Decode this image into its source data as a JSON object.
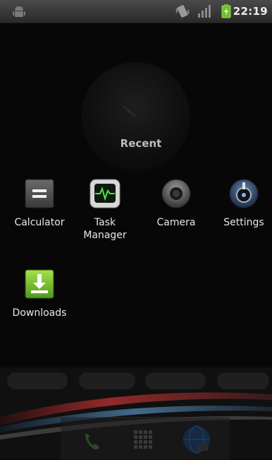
{
  "status_bar": {
    "time": "22:19",
    "icons": [
      "android-icon",
      "vibrate-icon",
      "signal-icon",
      "battery-charging-icon"
    ]
  },
  "recent": {
    "title": "Recent",
    "apps": [
      {
        "label": "Calculator",
        "icon": "calculator-icon"
      },
      {
        "label": "Task\nManager",
        "icon": "task-manager-icon"
      },
      {
        "label": "Camera",
        "icon": "camera-icon"
      },
      {
        "label": "Settings",
        "icon": "settings-icon"
      },
      {
        "label": "Downloads",
        "icon": "downloads-icon"
      }
    ]
  },
  "dock": {
    "icons": [
      "phone-icon",
      "app-drawer-icon",
      "browser-icon"
    ]
  }
}
